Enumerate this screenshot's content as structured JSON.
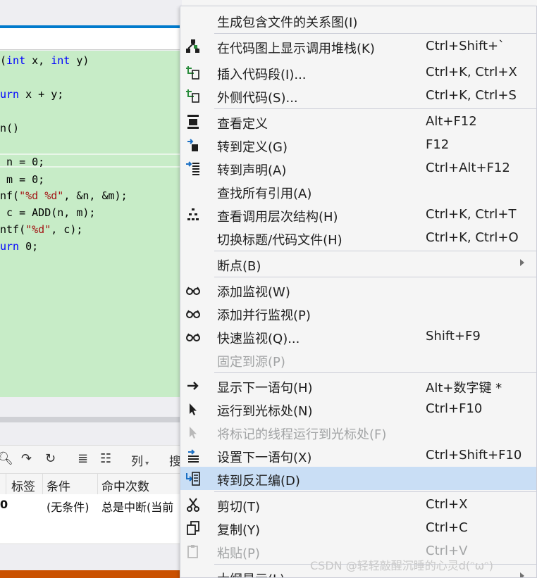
{
  "editor": {
    "lines": [
      {
        "parts": [
          {
            "t": "(",
            "c": ""
          },
          {
            "t": "int",
            "c": "kw"
          },
          {
            "t": " x, ",
            "c": ""
          },
          {
            "t": "int",
            "c": "kw"
          },
          {
            "t": " y)",
            "c": ""
          }
        ]
      },
      {
        "parts": [
          {
            "t": "urn",
            "c": "kw"
          },
          {
            "t": " x + y;",
            "c": ""
          }
        ]
      },
      {
        "parts": [
          {
            "t": "n()",
            "c": ""
          }
        ]
      },
      {
        "parts": [
          {
            "t": " n = 0;",
            "c": ""
          }
        ]
      },
      {
        "parts": [
          {
            "t": " m = 0;",
            "c": ""
          }
        ]
      },
      {
        "parts": [
          {
            "t": "nf(",
            "c": ""
          },
          {
            "t": "\"%d %d\"",
            "c": "str"
          },
          {
            "t": ", &n, &m);",
            "c": ""
          }
        ]
      },
      {
        "parts": [
          {
            "t": " c = ADD(n, m);",
            "c": ""
          }
        ]
      },
      {
        "parts": [
          {
            "t": "ntf(",
            "c": ""
          },
          {
            "t": "\"%d\"",
            "c": "str"
          },
          {
            "t": ", c);",
            "c": ""
          }
        ]
      },
      {
        "parts": [
          {
            "t": "urn",
            "c": "kw"
          },
          {
            "t": " 0;",
            "c": ""
          }
        ]
      }
    ]
  },
  "breakpoints_panel": {
    "toolbar": {
      "columns_label": "列",
      "cut_label": "搜"
    },
    "headers": [
      "标签",
      "条件",
      "命中次数"
    ],
    "row": {
      "first": "0",
      "condition": "(无条件)",
      "hit_count": "总是中断(当前"
    }
  },
  "context_menu": {
    "items": [
      {
        "label": "生成包含文件的关系图(I)",
        "shortcut": "",
        "icon": "none",
        "disabled": false
      },
      {
        "label": "在代码图上显示调用堆栈(K)",
        "shortcut": "Ctrl+Shift+`",
        "icon": "callstack-map-icon",
        "disabled": false,
        "sep_before": true
      },
      {
        "label": "插入代码段(I)...",
        "shortcut": "Ctrl+K, Ctrl+X",
        "icon": "insert-snippet-icon",
        "disabled": false
      },
      {
        "label": "外侧代码(S)...",
        "shortcut": "Ctrl+K, Ctrl+S",
        "icon": "surround-with-icon",
        "disabled": false
      },
      {
        "label": "查看定义",
        "shortcut": "Alt+F12",
        "icon": "peek-definition-icon",
        "disabled": false,
        "sep_before": true
      },
      {
        "label": "转到定义(G)",
        "shortcut": "F12",
        "icon": "go-to-definition-icon",
        "disabled": false
      },
      {
        "label": "转到声明(A)",
        "shortcut": "Ctrl+Alt+F12",
        "icon": "go-to-declaration-icon",
        "disabled": false
      },
      {
        "label": "查找所有引用(A)",
        "shortcut": "",
        "icon": "none",
        "disabled": false
      },
      {
        "label": "查看调用层次结构(H)",
        "shortcut": "Ctrl+K, Ctrl+T",
        "icon": "call-hierarchy-icon",
        "disabled": false
      },
      {
        "label": "切换标题/代码文件(H)",
        "shortcut": "Ctrl+K, Ctrl+O",
        "icon": "none",
        "disabled": false
      },
      {
        "label": "断点(B)",
        "shortcut": "",
        "icon": "none",
        "disabled": false,
        "submenu": true,
        "sep_before": true
      },
      {
        "label": "添加监视(W)",
        "shortcut": "",
        "icon": "watch-glasses-icon",
        "disabled": false,
        "sep_before": true
      },
      {
        "label": "添加并行监视(P)",
        "shortcut": "",
        "icon": "watch-glasses-icon",
        "disabled": false
      },
      {
        "label": "快速监视(Q)...",
        "shortcut": "Shift+F9",
        "icon": "watch-glasses-icon",
        "disabled": false
      },
      {
        "label": "固定到源(P)",
        "shortcut": "",
        "icon": "none",
        "disabled": true
      },
      {
        "label": "显示下一语句(H)",
        "shortcut": "Alt+数字键 *",
        "icon": "show-next-statement-icon",
        "disabled": false,
        "sep_before": true
      },
      {
        "label": "运行到光标处(N)",
        "shortcut": "Ctrl+F10",
        "icon": "run-to-cursor-icon",
        "disabled": false
      },
      {
        "label": "将标记的线程运行到光标处(F)",
        "shortcut": "",
        "icon": "run-to-cursor-icon",
        "disabled": true
      },
      {
        "label": "设置下一语句(X)",
        "shortcut": "Ctrl+Shift+F10",
        "icon": "set-next-statement-icon",
        "disabled": false
      },
      {
        "label": "转到反汇编(D)",
        "shortcut": "",
        "icon": "go-to-disassembly-icon",
        "disabled": false,
        "highlighted": true
      },
      {
        "label": "剪切(T)",
        "shortcut": "Ctrl+X",
        "icon": "scissors-icon",
        "disabled": false,
        "sep_before": true
      },
      {
        "label": "复制(Y)",
        "shortcut": "Ctrl+C",
        "icon": "copy-icon",
        "disabled": false
      },
      {
        "label": "粘贴(P)",
        "shortcut": "Ctrl+V",
        "icon": "paste-icon",
        "disabled": true
      },
      {
        "label": "大纲显示(L)",
        "shortcut": "",
        "icon": "none",
        "disabled": false,
        "submenu": true,
        "sep_before": true
      }
    ]
  },
  "watermark": "CSDN @轻轻敲醒沉睡的心灵d(ᵔωᵔ)"
}
